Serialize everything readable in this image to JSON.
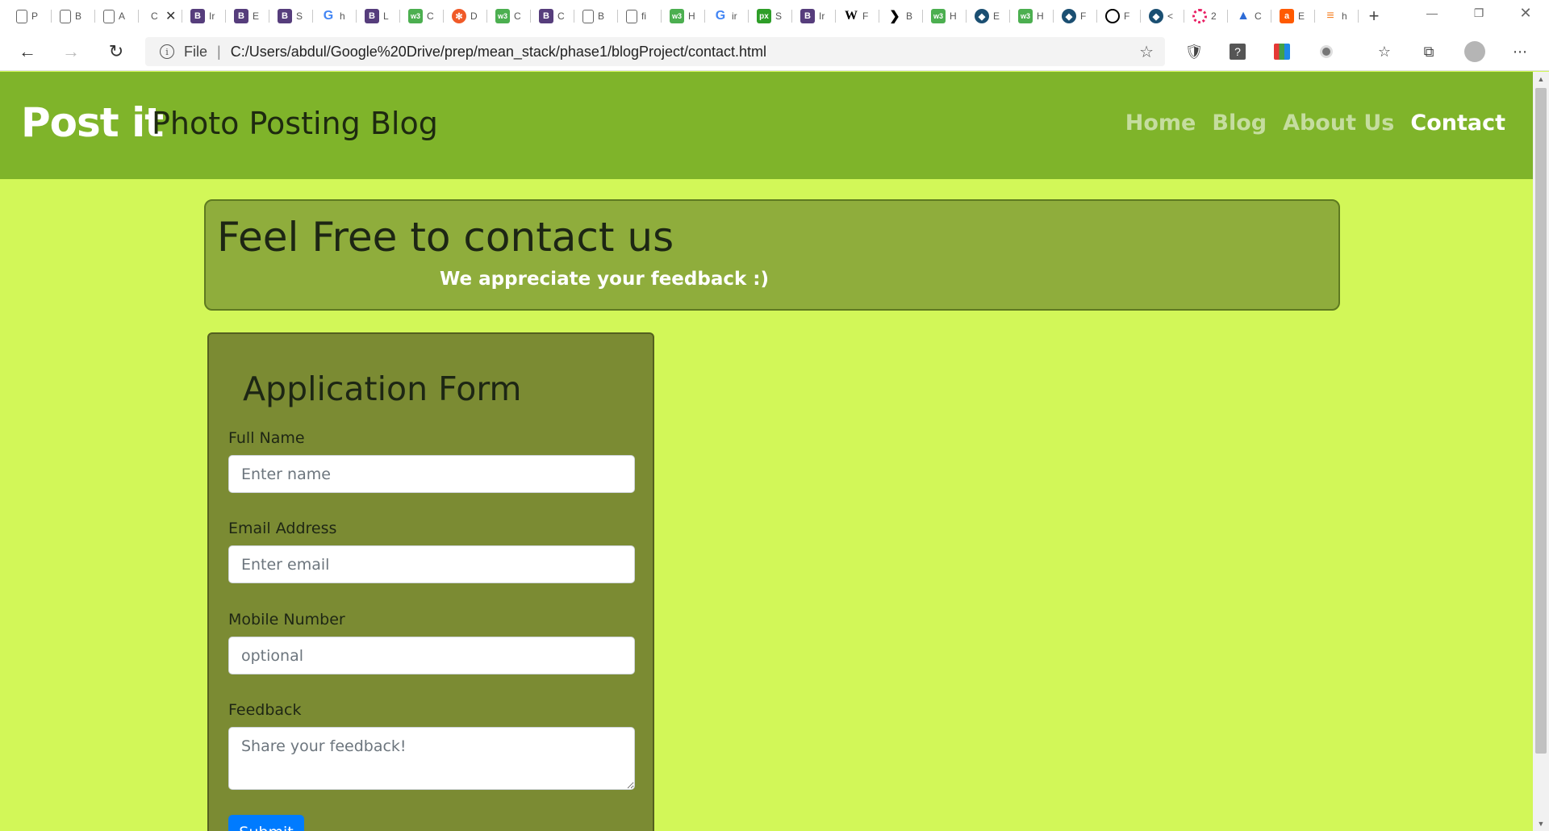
{
  "browser": {
    "tabs": [
      {
        "icon": "doc-icon",
        "letter": "P"
      },
      {
        "icon": "doc-icon",
        "letter": "B"
      },
      {
        "icon": "doc-icon",
        "letter": "A"
      },
      {
        "icon": "none",
        "letter": "C",
        "active": true
      },
      {
        "icon": "bootstrap-icon",
        "letter": "Ir"
      },
      {
        "icon": "bootstrap-icon",
        "letter": "E"
      },
      {
        "icon": "bootstrap-icon",
        "letter": "S"
      },
      {
        "icon": "google-icon",
        "letter": "h"
      },
      {
        "icon": "bootstrap-icon",
        "letter": "L"
      },
      {
        "icon": "w3schools-icon",
        "letter": "C"
      },
      {
        "icon": "orange-icon",
        "letter": "D"
      },
      {
        "icon": "w3schools-icon",
        "letter": "C"
      },
      {
        "icon": "bootstrap-icon",
        "letter": "C"
      },
      {
        "icon": "doc-icon",
        "letter": "B"
      },
      {
        "icon": "doc-icon",
        "letter": "fi"
      },
      {
        "icon": "w3schools-icon",
        "letter": "H"
      },
      {
        "icon": "google-icon",
        "letter": "ir"
      },
      {
        "icon": "px-icon",
        "letter": "S"
      },
      {
        "icon": "bootstrap-icon",
        "letter": "Ir"
      },
      {
        "icon": "wikipedia-icon",
        "letter": "F"
      },
      {
        "icon": "code-icon",
        "letter": "B"
      },
      {
        "icon": "w3schools-icon",
        "letter": "H"
      },
      {
        "icon": "dark-icon",
        "letter": "E"
      },
      {
        "icon": "w3schools-icon",
        "letter": "H"
      },
      {
        "icon": "dark-icon",
        "letter": "F"
      },
      {
        "icon": "codepen-icon",
        "letter": "F"
      },
      {
        "icon": "dark-icon",
        "letter": "<"
      },
      {
        "icon": "ring-icon",
        "letter": "2"
      },
      {
        "icon": "a-icon",
        "letter": "C"
      },
      {
        "icon": "amazon-icon",
        "letter": "E"
      },
      {
        "icon": "stackoverflow-icon",
        "letter": "h"
      }
    ],
    "new_tab": "+",
    "address": {
      "scheme_label": "File",
      "separator": "|",
      "url": "C:/Users/abdul/Google%20Drive/prep/mean_stack/phase1/blogProject/contact.html"
    }
  },
  "site": {
    "brand": "Post it",
    "tagline": "Photo Posting Blog",
    "nav": [
      "Home",
      "Blog",
      "About Us",
      "Contact"
    ],
    "active_nav": "Contact"
  },
  "hero": {
    "title": "Feel Free to contact us",
    "subtitle": "We appreciate your feedback :)"
  },
  "form": {
    "title": "Application Form",
    "name_label": "Full Name",
    "name_placeholder": "Enter name",
    "email_label": "Email Address",
    "email_placeholder": "Enter email",
    "mobile_label": "Mobile Number",
    "mobile_placeholder": "optional",
    "feedback_label": "Feedback",
    "feedback_placeholder": "Share your feedback!",
    "submit_label": "Submit"
  },
  "colors": {
    "header": "#7fb42a",
    "page_bg": "#d2f758",
    "hero_bg": "#8fad3c",
    "form_bg": "#7b8b33",
    "submit": "#007bff"
  }
}
